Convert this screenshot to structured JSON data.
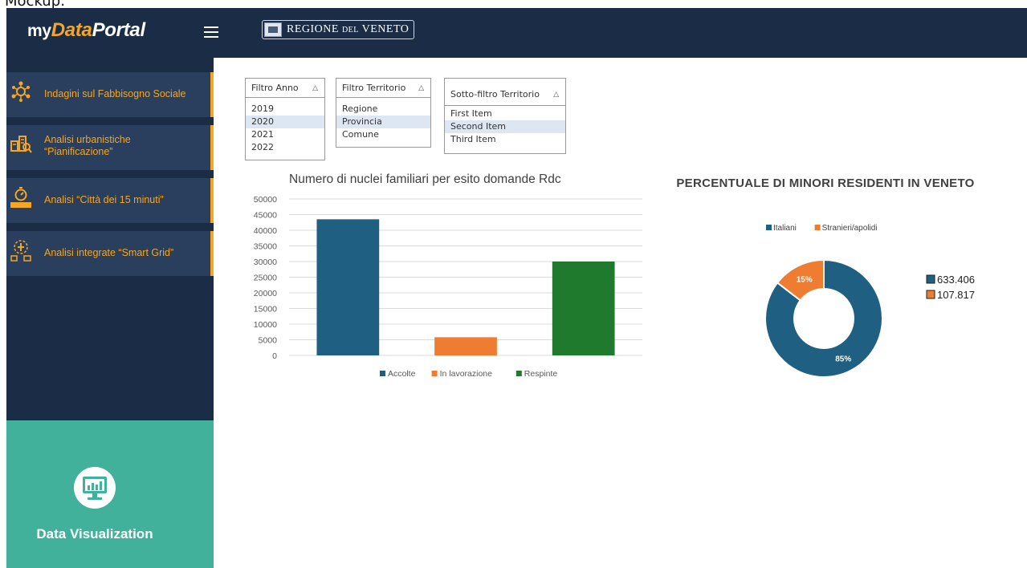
{
  "page": {
    "caption": "Mockup:"
  },
  "header": {
    "logo_my": "my",
    "logo_data": "Data",
    "logo_portal": "Portal",
    "menu_icon": "hamburger-menu-icon",
    "regione_main": "REGIONE",
    "regione_del": "DEL",
    "regione_veneto": "VENETO",
    "background": "#1b2d46",
    "accent": "#f5a623"
  },
  "sidebar": {
    "items": [
      {
        "label": "Indagini sul Fabbisogno Sociale",
        "icon": "social-network-icon"
      },
      {
        "label": "Analisi urbanistiche\n“Pianificazione”",
        "icon": "urban-planning-icon"
      },
      {
        "label": "Analisi “Città dei 15 minuti”",
        "icon": "stopwatch-15min-icon"
      },
      {
        "label": "Analisi integrate “Smart Grid”",
        "icon": "smart-grid-icon"
      }
    ],
    "data_visualization": {
      "label": "Data Visualization",
      "icon": "monitor-chart-icon",
      "color": "#41b19c"
    }
  },
  "filters": {
    "anno": {
      "label": "Filtro Anno",
      "options": [
        "2019",
        "2020",
        "2021",
        "2022"
      ],
      "selected": "2020"
    },
    "territorio": {
      "label": "Filtro Territorio",
      "options": [
        "Regione",
        "Provincia",
        "Comune"
      ],
      "selected": "Provincia"
    },
    "sotto_territorio": {
      "label": "Sotto-filtro Territorio",
      "options": [
        "First Item",
        "Second Item",
        "Third Item"
      ],
      "selected": "Second Item"
    }
  },
  "chart_data": [
    {
      "type": "bar",
      "title": "Numero di nuclei familiari per esito domande Rdc",
      "categories": [
        "Accolte",
        "In lavorazione",
        "Respinte"
      ],
      "values": [
        43500,
        5800,
        30000
      ],
      "colors": [
        "#1f5f82",
        "#ee7d31",
        "#1f7a2e"
      ],
      "ylim": [
        0,
        50000
      ],
      "yticks": [
        "50000",
        "45000",
        "40000",
        "35000",
        "30000",
        "25000",
        "20000",
        "15000",
        "10000",
        "5000",
        "0"
      ],
      "grid": true,
      "legend": "bottom"
    },
    {
      "type": "pie",
      "title": "PERCENTUALE  DI MINORI RESIDENTI  IN VENETO",
      "series": [
        {
          "name": "Italiani",
          "value": 633406,
          "label": "633.406",
          "percent": "85%",
          "color": "#1f5f82"
        },
        {
          "name": "Stranieri/apolidi",
          "value": 107817,
          "label": "107.817",
          "percent": "15%",
          "color": "#ee7d31"
        }
      ],
      "legend": "top"
    }
  ]
}
